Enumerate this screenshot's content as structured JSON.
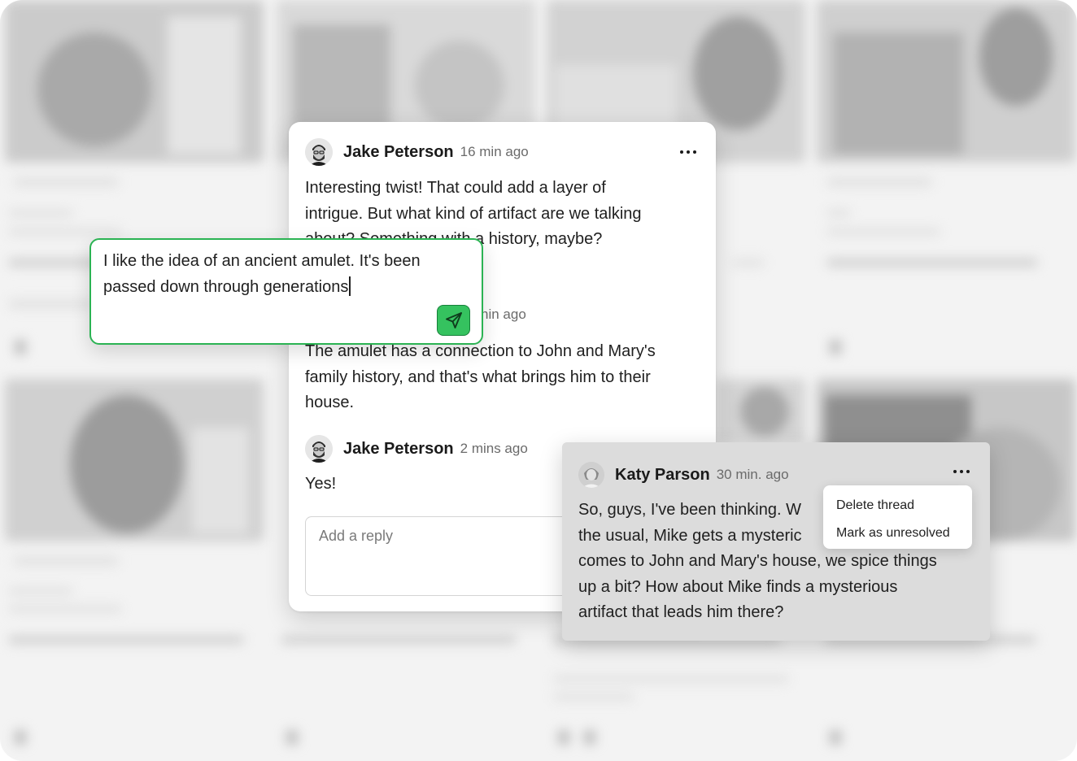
{
  "main_thread": {
    "comments": [
      {
        "author": "Jake Peterson",
        "time": "16 min ago",
        "lines": [
          "Interesting twist! That could add a layer of",
          "intrigue. But what kind of artifact are we talking",
          "about? Something with a history, maybe?"
        ]
      },
      {
        "author": "",
        "time": "nin ago",
        "lines": [
          "The amulet has a connection to John and Mary's",
          "family history, and that's what brings him to their",
          "house."
        ]
      },
      {
        "author": "Jake Peterson",
        "time": "2 mins ago",
        "lines": [
          "Yes!"
        ]
      }
    ],
    "reply_placeholder": "Add a reply"
  },
  "editor": {
    "lines": [
      "I like the idea of an ancient amulet. It's been",
      "passed down through generations"
    ]
  },
  "side_thread": {
    "author": "Katy Parson",
    "time": "30 min. ago",
    "lines": [
      "So, guys, I've been thinking. W",
      "the usual, Mike gets a mysteric",
      "comes to John and Mary's house, we spice things",
      "up a bit? How about Mike finds a mysterious",
      "artifact that leads him there?"
    ]
  },
  "menu": {
    "items": [
      "Delete thread",
      "Mark as unresolved"
    ]
  },
  "colors": {
    "accent_green": "#35c25f",
    "editor_border": "#2bb353",
    "side_card_bg": "#dcdcdc"
  },
  "icons": {
    "send": "send-icon",
    "more": "more-horizontal-icon"
  }
}
